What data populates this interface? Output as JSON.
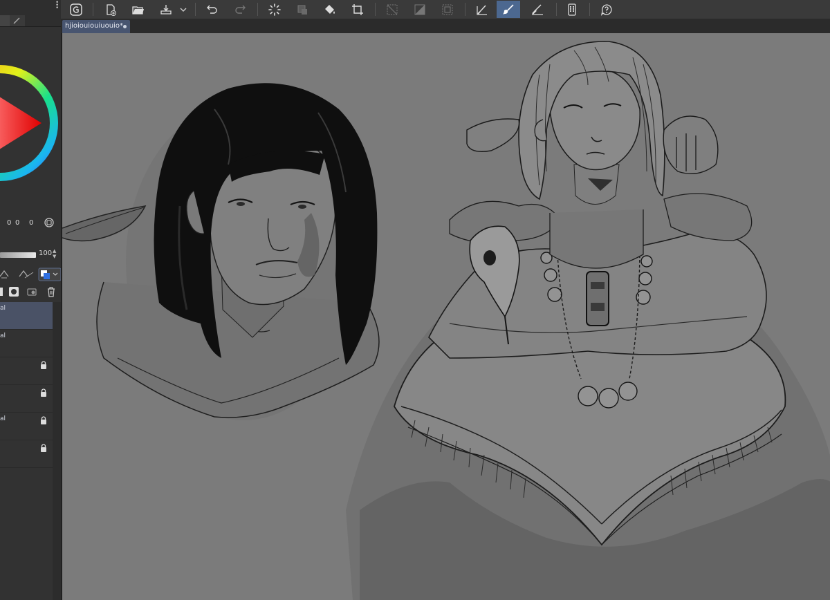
{
  "document": {
    "tab_title": "hjioiouiouiuouio*"
  },
  "color_panel": {
    "values": [
      "0",
      "0",
      "0"
    ]
  },
  "layer_panel": {
    "opacity": "100",
    "layers": [
      {
        "name": "al",
        "active": true,
        "locked": false
      },
      {
        "name": "al",
        "active": false,
        "locked": false
      },
      {
        "name": "",
        "active": false,
        "locked": true
      },
      {
        "name": "",
        "active": false,
        "locked": true
      },
      {
        "name": "al",
        "active": false,
        "locked": true
      },
      {
        "name": "",
        "active": false,
        "locked": true
      }
    ]
  },
  "toolbar": {
    "buttons": [
      {
        "name": "clip-studio-icon"
      },
      {
        "name": "new-canvas-icon"
      },
      {
        "name": "open-folder-icon"
      },
      {
        "name": "export-icon"
      },
      {
        "name": "export-dropdown-icon"
      },
      {
        "name": "undo-icon"
      },
      {
        "name": "redo-icon"
      },
      {
        "name": "loading-spinner-icon"
      },
      {
        "name": "transform-icon"
      },
      {
        "name": "fill-bucket-icon"
      },
      {
        "name": "crop-icon"
      },
      {
        "name": "clear-selection-icon"
      },
      {
        "name": "invert-selection-icon"
      },
      {
        "name": "selection-border-icon"
      },
      {
        "name": "pen-tool-icon"
      },
      {
        "name": "brush-tool-icon"
      },
      {
        "name": "eraser-tool-icon"
      },
      {
        "name": "tablet-mode-icon"
      },
      {
        "name": "help-icon"
      }
    ]
  },
  "colors": {
    "canvas_bg": "#7b7b7b",
    "active_layer": "#4a5266",
    "tab_bg": "#485570",
    "active_tool": "#4c6890"
  }
}
